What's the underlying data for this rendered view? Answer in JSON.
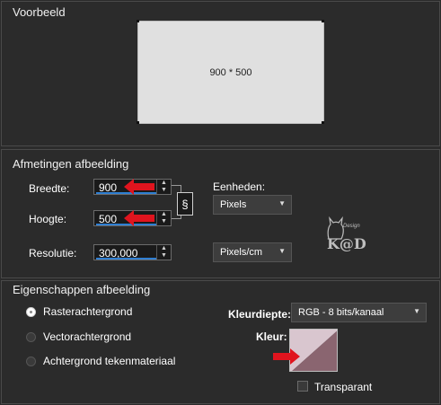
{
  "preview": {
    "title": "Voorbeeld",
    "size_text": "900 * 500"
  },
  "dimensions": {
    "title": "Afmetingen afbeelding",
    "width_label": "Breedte:",
    "width_value": "900",
    "height_label": "Hoogte:",
    "height_value": "500",
    "resolution_label": "Resolutie:",
    "resolution_value": "300,000",
    "units_label": "Eenheden:",
    "units_value": "Pixels",
    "res_units_value": "Pixels/cm"
  },
  "properties": {
    "title": "Eigenschappen afbeelding",
    "options": [
      {
        "label": "Rasterachtergrond",
        "selected": true
      },
      {
        "label": "Vectorachtergrond",
        "selected": false
      },
      {
        "label": "Achtergrond tekenmateriaal",
        "selected": false
      }
    ],
    "color_depth_label": "Kleurdiepte:",
    "color_depth_value": "RGB - 8 bits/kanaal",
    "color_label": "Kleur:",
    "transparent_label": "Transparant",
    "transparent_checked": false
  },
  "watermark": {
    "text": "K@D",
    "small_text": "Design"
  },
  "colors": {
    "accent_blue": "#2f7fd3",
    "arrow_red": "#e0141e",
    "swatch_light": "#d9c6cf",
    "swatch_dark": "#8a6570"
  },
  "icons": {
    "link": "link-chain-icon",
    "dropdown": "chevron-down-icon"
  }
}
